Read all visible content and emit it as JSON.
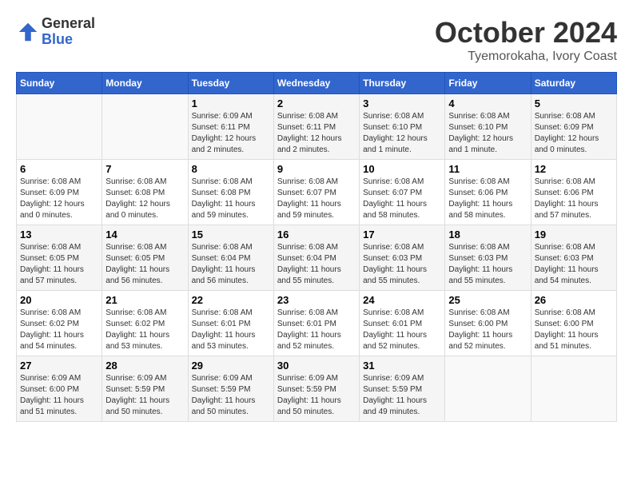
{
  "logo": {
    "general": "General",
    "blue": "Blue"
  },
  "title": "October 2024",
  "location": "Tyemorokaha, Ivory Coast",
  "days_of_week": [
    "Sunday",
    "Monday",
    "Tuesday",
    "Wednesday",
    "Thursday",
    "Friday",
    "Saturday"
  ],
  "weeks": [
    [
      {
        "day": "",
        "sunrise": "",
        "sunset": "",
        "daylight": ""
      },
      {
        "day": "",
        "sunrise": "",
        "sunset": "",
        "daylight": ""
      },
      {
        "day": "1",
        "sunrise": "Sunrise: 6:09 AM",
        "sunset": "Sunset: 6:11 PM",
        "daylight": "Daylight: 12 hours and 2 minutes."
      },
      {
        "day": "2",
        "sunrise": "Sunrise: 6:08 AM",
        "sunset": "Sunset: 6:11 PM",
        "daylight": "Daylight: 12 hours and 2 minutes."
      },
      {
        "day": "3",
        "sunrise": "Sunrise: 6:08 AM",
        "sunset": "Sunset: 6:10 PM",
        "daylight": "Daylight: 12 hours and 1 minute."
      },
      {
        "day": "4",
        "sunrise": "Sunrise: 6:08 AM",
        "sunset": "Sunset: 6:10 PM",
        "daylight": "Daylight: 12 hours and 1 minute."
      },
      {
        "day": "5",
        "sunrise": "Sunrise: 6:08 AM",
        "sunset": "Sunset: 6:09 PM",
        "daylight": "Daylight: 12 hours and 0 minutes."
      }
    ],
    [
      {
        "day": "6",
        "sunrise": "Sunrise: 6:08 AM",
        "sunset": "Sunset: 6:09 PM",
        "daylight": "Daylight: 12 hours and 0 minutes."
      },
      {
        "day": "7",
        "sunrise": "Sunrise: 6:08 AM",
        "sunset": "Sunset: 6:08 PM",
        "daylight": "Daylight: 12 hours and 0 minutes."
      },
      {
        "day": "8",
        "sunrise": "Sunrise: 6:08 AM",
        "sunset": "Sunset: 6:08 PM",
        "daylight": "Daylight: 11 hours and 59 minutes."
      },
      {
        "day": "9",
        "sunrise": "Sunrise: 6:08 AM",
        "sunset": "Sunset: 6:07 PM",
        "daylight": "Daylight: 11 hours and 59 minutes."
      },
      {
        "day": "10",
        "sunrise": "Sunrise: 6:08 AM",
        "sunset": "Sunset: 6:07 PM",
        "daylight": "Daylight: 11 hours and 58 minutes."
      },
      {
        "day": "11",
        "sunrise": "Sunrise: 6:08 AM",
        "sunset": "Sunset: 6:06 PM",
        "daylight": "Daylight: 11 hours and 58 minutes."
      },
      {
        "day": "12",
        "sunrise": "Sunrise: 6:08 AM",
        "sunset": "Sunset: 6:06 PM",
        "daylight": "Daylight: 11 hours and 57 minutes."
      }
    ],
    [
      {
        "day": "13",
        "sunrise": "Sunrise: 6:08 AM",
        "sunset": "Sunset: 6:05 PM",
        "daylight": "Daylight: 11 hours and 57 minutes."
      },
      {
        "day": "14",
        "sunrise": "Sunrise: 6:08 AM",
        "sunset": "Sunset: 6:05 PM",
        "daylight": "Daylight: 11 hours and 56 minutes."
      },
      {
        "day": "15",
        "sunrise": "Sunrise: 6:08 AM",
        "sunset": "Sunset: 6:04 PM",
        "daylight": "Daylight: 11 hours and 56 minutes."
      },
      {
        "day": "16",
        "sunrise": "Sunrise: 6:08 AM",
        "sunset": "Sunset: 6:04 PM",
        "daylight": "Daylight: 11 hours and 55 minutes."
      },
      {
        "day": "17",
        "sunrise": "Sunrise: 6:08 AM",
        "sunset": "Sunset: 6:03 PM",
        "daylight": "Daylight: 11 hours and 55 minutes."
      },
      {
        "day": "18",
        "sunrise": "Sunrise: 6:08 AM",
        "sunset": "Sunset: 6:03 PM",
        "daylight": "Daylight: 11 hours and 55 minutes."
      },
      {
        "day": "19",
        "sunrise": "Sunrise: 6:08 AM",
        "sunset": "Sunset: 6:03 PM",
        "daylight": "Daylight: 11 hours and 54 minutes."
      }
    ],
    [
      {
        "day": "20",
        "sunrise": "Sunrise: 6:08 AM",
        "sunset": "Sunset: 6:02 PM",
        "daylight": "Daylight: 11 hours and 54 minutes."
      },
      {
        "day": "21",
        "sunrise": "Sunrise: 6:08 AM",
        "sunset": "Sunset: 6:02 PM",
        "daylight": "Daylight: 11 hours and 53 minutes."
      },
      {
        "day": "22",
        "sunrise": "Sunrise: 6:08 AM",
        "sunset": "Sunset: 6:01 PM",
        "daylight": "Daylight: 11 hours and 53 minutes."
      },
      {
        "day": "23",
        "sunrise": "Sunrise: 6:08 AM",
        "sunset": "Sunset: 6:01 PM",
        "daylight": "Daylight: 11 hours and 52 minutes."
      },
      {
        "day": "24",
        "sunrise": "Sunrise: 6:08 AM",
        "sunset": "Sunset: 6:01 PM",
        "daylight": "Daylight: 11 hours and 52 minutes."
      },
      {
        "day": "25",
        "sunrise": "Sunrise: 6:08 AM",
        "sunset": "Sunset: 6:00 PM",
        "daylight": "Daylight: 11 hours and 52 minutes."
      },
      {
        "day": "26",
        "sunrise": "Sunrise: 6:08 AM",
        "sunset": "Sunset: 6:00 PM",
        "daylight": "Daylight: 11 hours and 51 minutes."
      }
    ],
    [
      {
        "day": "27",
        "sunrise": "Sunrise: 6:09 AM",
        "sunset": "Sunset: 6:00 PM",
        "daylight": "Daylight: 11 hours and 51 minutes."
      },
      {
        "day": "28",
        "sunrise": "Sunrise: 6:09 AM",
        "sunset": "Sunset: 5:59 PM",
        "daylight": "Daylight: 11 hours and 50 minutes."
      },
      {
        "day": "29",
        "sunrise": "Sunrise: 6:09 AM",
        "sunset": "Sunset: 5:59 PM",
        "daylight": "Daylight: 11 hours and 50 minutes."
      },
      {
        "day": "30",
        "sunrise": "Sunrise: 6:09 AM",
        "sunset": "Sunset: 5:59 PM",
        "daylight": "Daylight: 11 hours and 50 minutes."
      },
      {
        "day": "31",
        "sunrise": "Sunrise: 6:09 AM",
        "sunset": "Sunset: 5:59 PM",
        "daylight": "Daylight: 11 hours and 49 minutes."
      },
      {
        "day": "",
        "sunrise": "",
        "sunset": "",
        "daylight": ""
      },
      {
        "day": "",
        "sunrise": "",
        "sunset": "",
        "daylight": ""
      }
    ]
  ]
}
